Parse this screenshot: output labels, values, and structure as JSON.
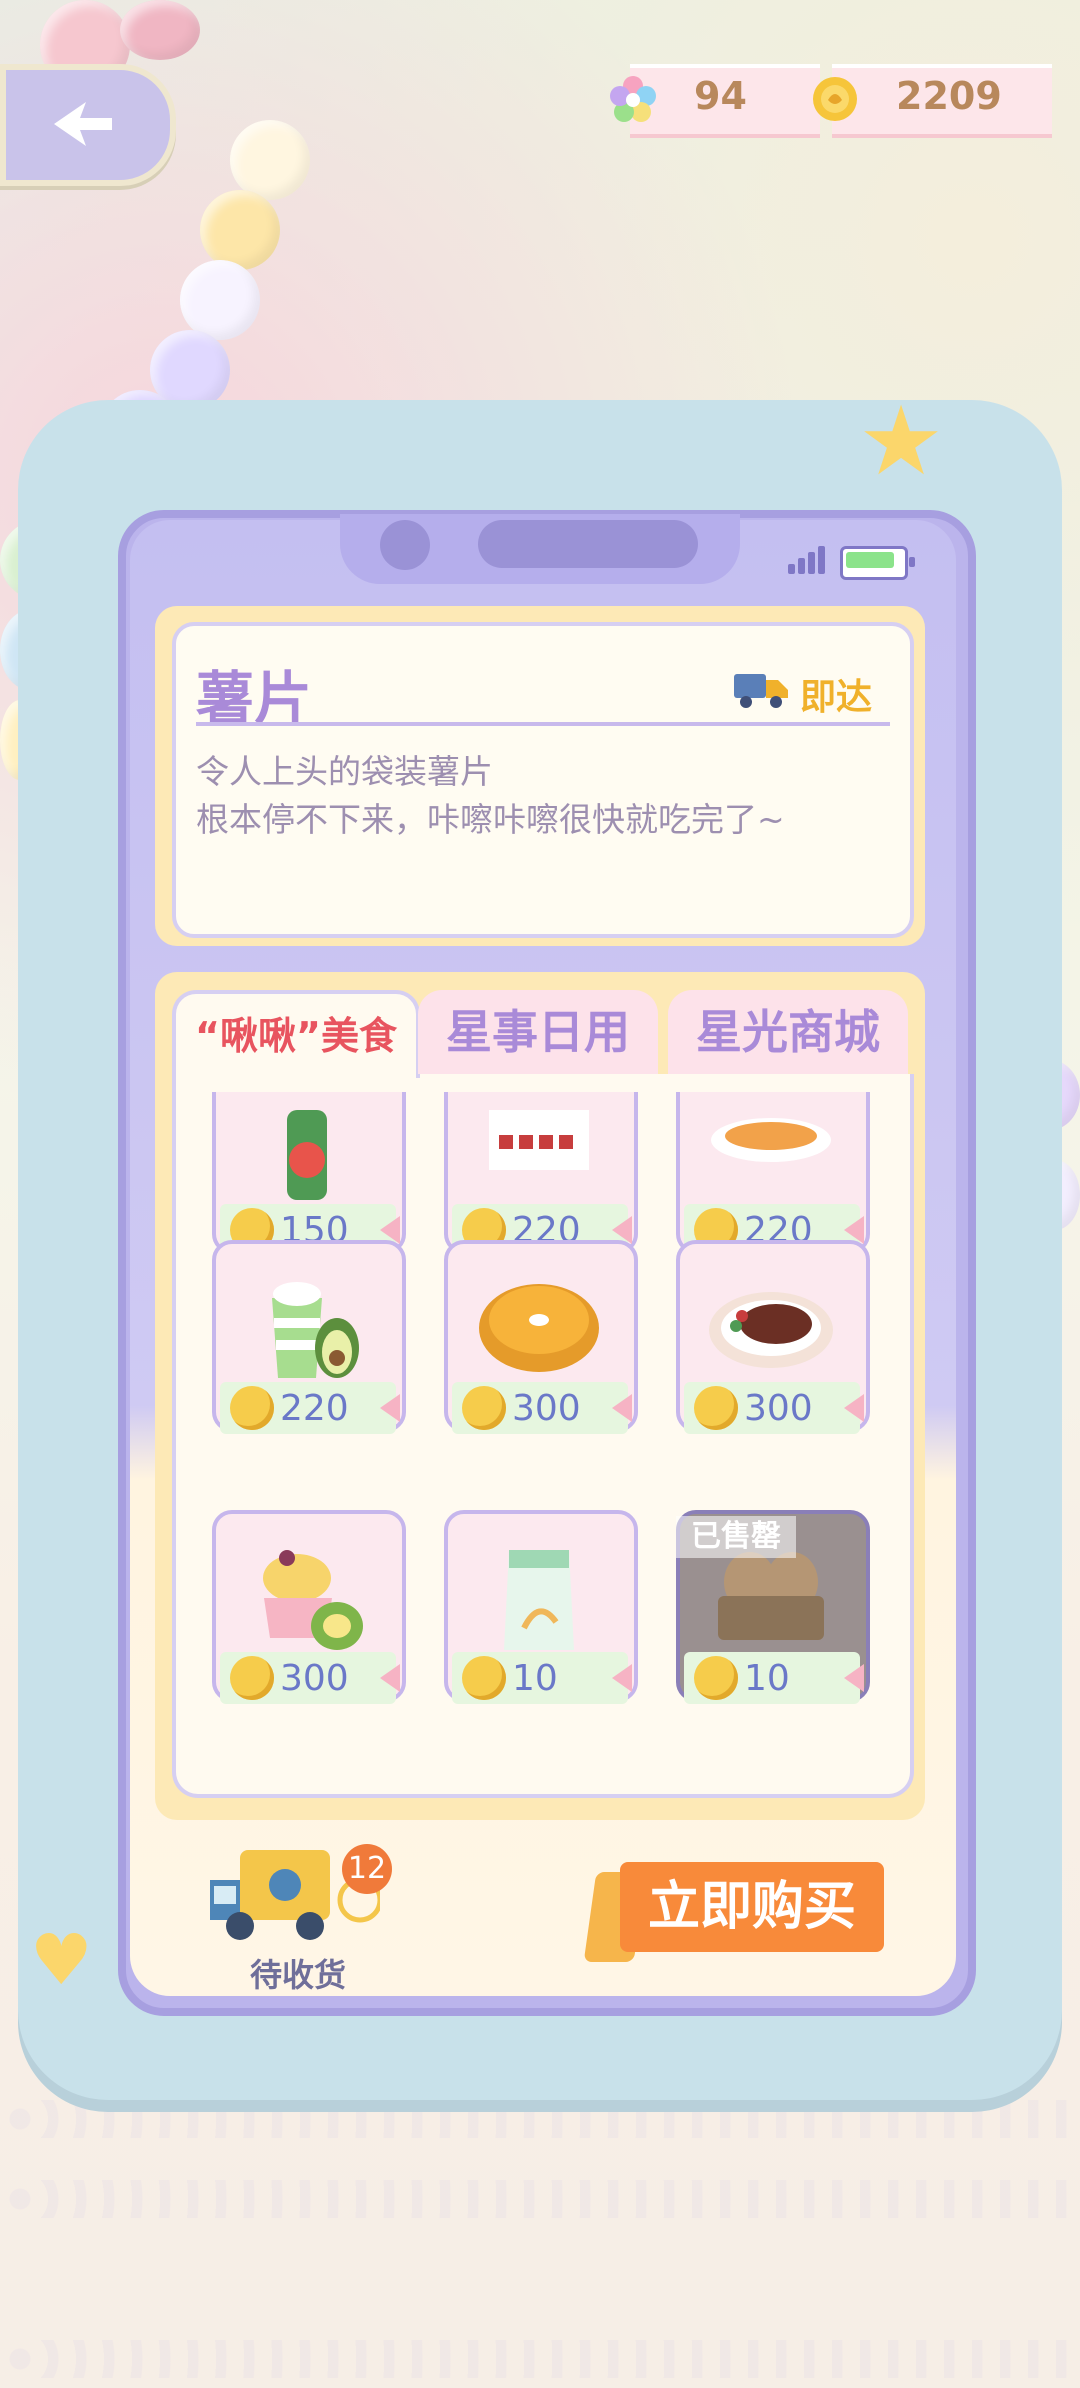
{
  "currency": {
    "gems": {
      "icon": "flower-gem-icon",
      "value": "94"
    },
    "coins": {
      "icon": "coin-icon",
      "value": "2209"
    }
  },
  "item": {
    "title": "薯片",
    "delivery_icon": "truck-icon",
    "delivery_label": "即达",
    "description_line1": "令人上头的袋装薯片",
    "description_line2": "根本停不下来，咔嚓咔嚓很快就吃完了~"
  },
  "tabs": [
    {
      "label": "“啾啾”美食",
      "active": true
    },
    {
      "label": "星事日用",
      "active": false
    },
    {
      "label": "星光商城",
      "active": false
    }
  ],
  "products": [
    {
      "icon": "tomato-juice-bottle-icon",
      "price": "150",
      "sold_out": false
    },
    {
      "icon": "food-box-icon",
      "price": "220",
      "sold_out": false
    },
    {
      "icon": "pizza-plate-icon",
      "price": "220",
      "sold_out": false
    },
    {
      "icon": "avocado-smoothie-icon",
      "price": "220",
      "sold_out": false
    },
    {
      "icon": "pumpkin-pie-icon",
      "price": "300",
      "sold_out": false
    },
    {
      "icon": "steak-plate-icon",
      "price": "300",
      "sold_out": false
    },
    {
      "icon": "durian-dessert-icon",
      "price": "300",
      "sold_out": false
    },
    {
      "icon": "flour-bag-icon",
      "price": "10",
      "sold_out": false
    },
    {
      "icon": "egg-carton-icon",
      "price": "10",
      "sold_out": true,
      "badge": "已售罄"
    }
  ],
  "bottom": {
    "pending_count": "12",
    "pending_label": "待收货",
    "buy_label": "立即购买"
  },
  "colors": {
    "accent": "#a98ad8",
    "buy_button": "#f88a3a",
    "active_tab_text": "#e8545f",
    "price_text": "#6a78c8"
  }
}
